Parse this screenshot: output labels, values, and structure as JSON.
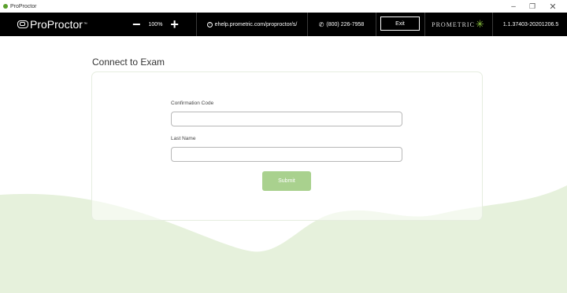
{
  "window": {
    "title": "ProProctor",
    "minimize_glyph": "–",
    "maximize_glyph": "❐",
    "close_glyph": "✕"
  },
  "toolbar": {
    "logo_text": "ProProctor",
    "logo_mark": "™",
    "zoom_out": "−",
    "zoom_value": "100%",
    "zoom_in": "+",
    "help_icon": "?",
    "help_link": "ehelp.prometric.com/proproctor/s/",
    "phone_icon": "✆",
    "phone": "(800) 226-7958",
    "exit_label": "Exit",
    "brand": "PROMETRIC",
    "brand_mark": "✳",
    "version": "1.1.37403-20201206.5"
  },
  "main": {
    "title": "Connect to Exam",
    "confirmation_label": "Confirmation Code",
    "confirmation_value": "",
    "last_name_label": "Last Name",
    "last_name_value": "",
    "submit_label": "Submit"
  },
  "colors": {
    "toolbar_bg": "#000000",
    "accent_green": "#a9d18e",
    "wave_green": "#e6f1dc",
    "brand_green": "#8dc63f"
  }
}
